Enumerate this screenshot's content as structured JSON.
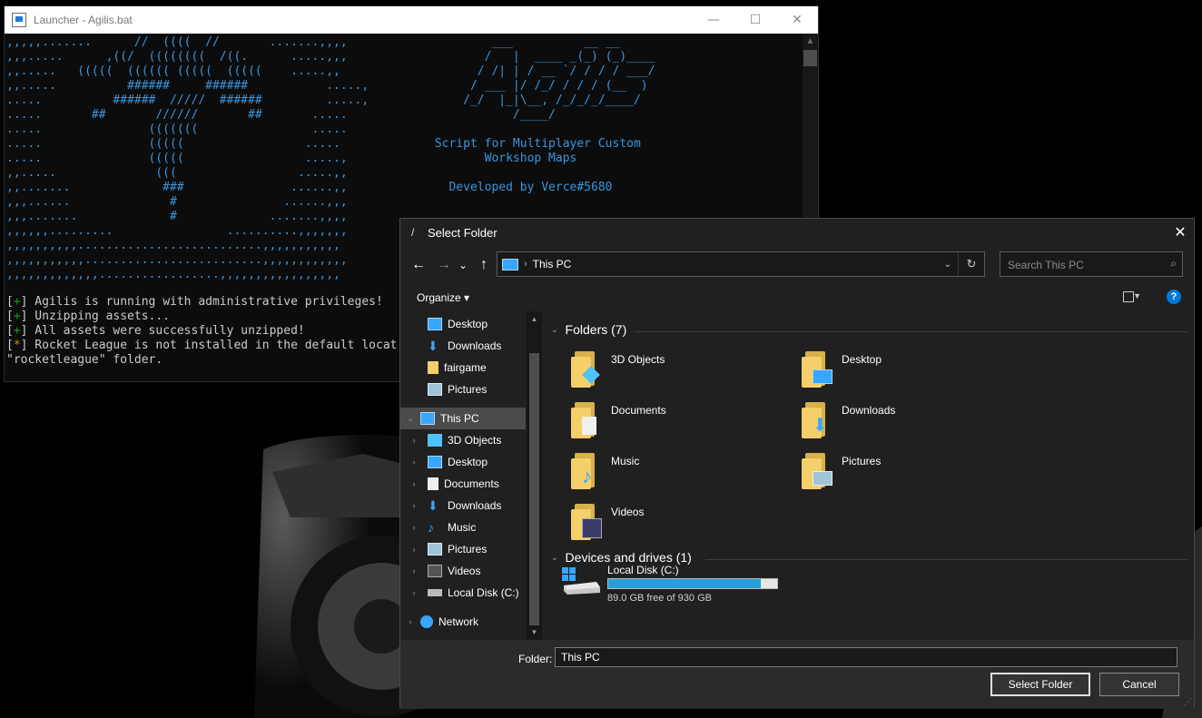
{
  "console": {
    "title": "Launcher - Agilis.bat",
    "caption_min": "—",
    "caption_max": "☐",
    "caption_close": "✕",
    "art": ",,,,,.......      //  ((((  //       .......,,,,\n,,,.....      ,((/  ((((((((  /((.      .....,,,\n,,.....   (((((  (((((( (((((  (((((    .....,,\n,,.....          ######     ######           .....,\n.....          ######  /////  ######         .....,\n.....       ##       //////       ##       .....\n.....               (((((((                .....\n.....               (((((                 .....\n.....               (((((                 .....,\n,,.....              (((                 .....,,\n,,.......             ###               ......,,\n,,,......              #               ......,,,\n,,,.......             #             .......,,,,\n,,,,,,.........                ..........,,,,,,,\n,,,,,,,,,,..........................,,,,,,,,,,,\n,,,,,,,,,,,.........................,,,,,,,,,,,,\n,,,,,,,,,,,,,.................,,,,,,,,,,,,,,,,,",
    "logo": "         ___          __ __\n        /   |  ____ _(_) (_)____\n       / /| | / __ `/ / / / ___/\n      / ___ |/ /_/ / / / (__  )\n     /_/  |_|\\__, /_/_/_/____/\n            /____/\n\n Script for Multiplayer Custom\n        Workshop Maps\n\n   Developed by Verce#5680",
    "logs": [
      {
        "tag": "+",
        "text": " Agilis is running with administrative privileges!"
      },
      {
        "tag": "+",
        "text": " Unzipping assets..."
      },
      {
        "tag": "+",
        "text": " All assets were successfully unzipped!"
      },
      {
        "tag": "*",
        "text": " Rocket League is not installed in the default locat"
      }
    ],
    "log_tail": "\"rocketleague\" folder."
  },
  "dialog": {
    "title": "Select Folder",
    "close": "✕",
    "nav": {
      "back": "←",
      "forward": "→",
      "recent": "⌄",
      "up": "↑"
    },
    "address": {
      "path": "This PC"
    },
    "search": {
      "placeholder": "Search This PC"
    },
    "organize": "Organize ▾",
    "help": "?",
    "navpane": [
      {
        "label": "Desktop",
        "icon": "desktop-icon",
        "chev": ""
      },
      {
        "label": "Downloads",
        "icon": "downloads-icon",
        "chev": ""
      },
      {
        "label": "fairgame",
        "icon": "folder-icon",
        "chev": ""
      },
      {
        "label": "Pictures",
        "icon": "pictures-icon",
        "chev": ""
      },
      {
        "label": "This PC",
        "icon": "this-pc-icon",
        "chev": "⌄",
        "selected": true
      },
      {
        "label": "3D Objects",
        "icon": "3d-objects-icon",
        "chev": "›"
      },
      {
        "label": "Desktop",
        "icon": "desktop-icon",
        "chev": "›"
      },
      {
        "label": "Documents",
        "icon": "documents-icon",
        "chev": "›"
      },
      {
        "label": "Downloads",
        "icon": "downloads-icon",
        "chev": "›"
      },
      {
        "label": "Music",
        "icon": "music-icon",
        "chev": "›"
      },
      {
        "label": "Pictures",
        "icon": "pictures-icon",
        "chev": "›"
      },
      {
        "label": "Videos",
        "icon": "videos-icon",
        "chev": "›"
      },
      {
        "label": "Local Disk (C:)",
        "icon": "drive-icon",
        "chev": "›"
      },
      {
        "label": "Network",
        "icon": "network-icon",
        "chev": "›"
      }
    ],
    "folders_header": "Folders (7)",
    "folders": [
      {
        "name": "3D Objects",
        "icon": "3d-objects-icon"
      },
      {
        "name": "Desktop",
        "icon": "desktop-icon"
      },
      {
        "name": "Documents",
        "icon": "documents-icon"
      },
      {
        "name": "Downloads",
        "icon": "downloads-icon"
      },
      {
        "name": "Music",
        "icon": "music-icon"
      },
      {
        "name": "Pictures",
        "icon": "pictures-icon"
      },
      {
        "name": "Videos",
        "icon": "videos-icon"
      }
    ],
    "devices_header": "Devices and drives (1)",
    "drive": {
      "name": "Local Disk (C:)",
      "free_text": "89.0 GB free of 930 GB",
      "used_fraction": 0.904
    },
    "footer": {
      "folder_label": "Folder:",
      "folder_value": "This PC",
      "select_button": "Select Folder",
      "cancel_button": "Cancel"
    }
  },
  "colors": {
    "accent": "#0078d7",
    "console_blue": "#3a96dd",
    "console_green": "#13a10e",
    "console_yellow": "#c19c00"
  }
}
